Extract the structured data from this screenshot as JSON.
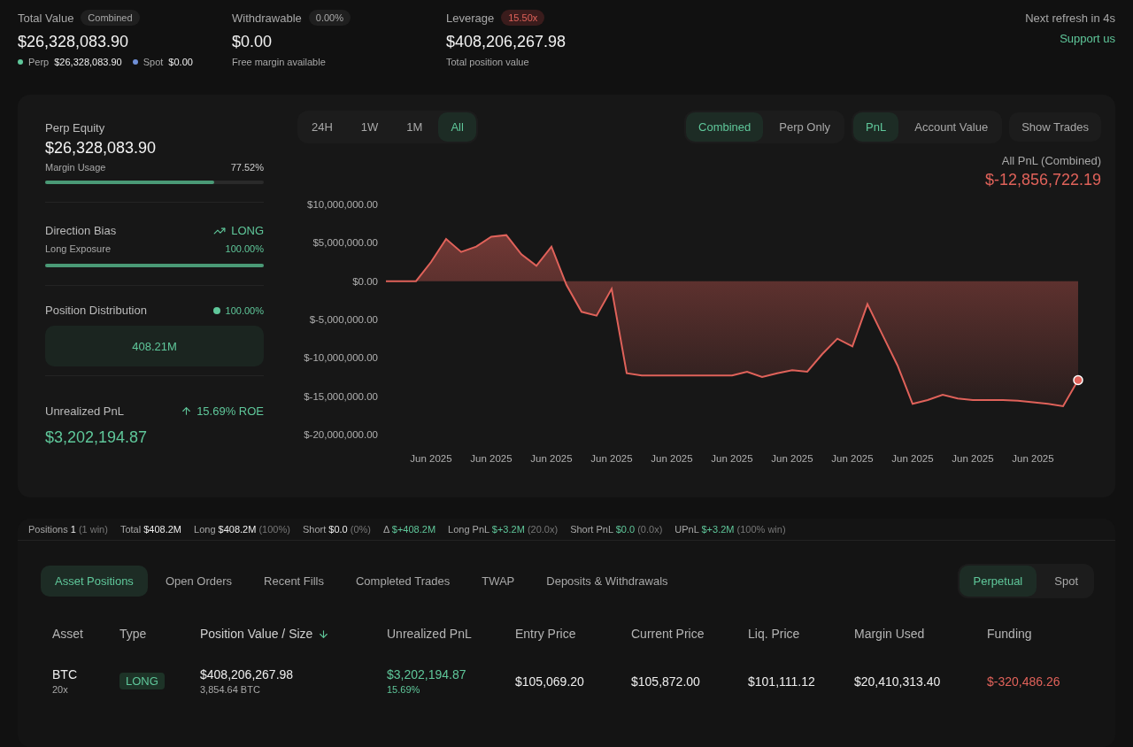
{
  "metrics": [
    {
      "label": "Total Value",
      "badge": "Combined",
      "alert": false,
      "value": "$26,328,083.90",
      "breakdown": [
        {
          "label": "Perp",
          "value": "$26,328,083.90",
          "color": "#5fc79a"
        },
        {
          "label": "Spot",
          "value": "$0.00",
          "color": "#6f8fd6"
        }
      ]
    },
    {
      "label": "Withdrawable",
      "badge": "0.00%",
      "alert": false,
      "value": "$0.00",
      "note": "Free margin available"
    },
    {
      "label": "Leverage",
      "badge": "15.50x",
      "alert": true,
      "value": "$408,206,267.98",
      "note": "Total position value"
    }
  ],
  "refresh": "Next refresh in 4s",
  "support_link": "Support us",
  "perp_equity": {
    "label": "Perp Equity",
    "value": "$26,328,083.90",
    "meter": {
      "label": "Margin Usage",
      "reading": "77.52%",
      "level": 0.7752
    }
  },
  "direction_bias": {
    "label": "Direction Bias",
    "direction": "LONG",
    "long": true,
    "meter": {
      "label": "Long Exposure",
      "reading": "100.00%",
      "level": 1
    }
  },
  "position_distribution": {
    "label": "Position Distribution",
    "reading": "100.00%",
    "color": "#5fc79a",
    "bar_label": "408.21M"
  },
  "unrealized_pnl": {
    "label": "Unrealized PnL",
    "roe": "15.69% ROE",
    "value": "$3,202,194.87"
  },
  "range_tabs": [
    {
      "label": "24H",
      "selected": false
    },
    {
      "label": "1W",
      "selected": false
    },
    {
      "label": "1M",
      "selected": false
    },
    {
      "label": "All",
      "selected": true
    }
  ],
  "mode_tabs": [
    {
      "label": "Combined",
      "selected": true
    },
    {
      "label": "Perp Only",
      "selected": false
    }
  ],
  "metric_tabs": [
    {
      "label": "PnL",
      "selected": true
    },
    {
      "label": "Account Value",
      "selected": false
    }
  ],
  "show_trades": "Show Trades",
  "chart": {
    "title": "All PnL (Combined)",
    "total": "$-12,856,722.19",
    "chart_data": {
      "type": "area",
      "categories": [
        null,
        null,
        null,
        "Jun 2025",
        null,
        null,
        null,
        "Jun 2025",
        null,
        null,
        null,
        "Jun 2025",
        null,
        null,
        null,
        "Jun 2025",
        null,
        null,
        null,
        "Jun 2025",
        null,
        null,
        null,
        "Jun 2025",
        null,
        null,
        null,
        "Jun 2025",
        null,
        null,
        null,
        "Jun 2025",
        null,
        null,
        null,
        "Jun 2025",
        null,
        null,
        null,
        "Jun 2025",
        null,
        null,
        null,
        "Jun 2025",
        null,
        null,
        null
      ],
      "values": [
        0,
        0,
        0,
        2500000,
        5500000,
        3800000,
        4500000,
        5800000,
        6000000,
        3500000,
        2000000,
        4500000,
        -500000,
        -4000000,
        -4500000,
        -1000000,
        -12000000,
        -12300000,
        -12300000,
        -12300000,
        -12300000,
        -12300000,
        -12300000,
        -12300000,
        -11800000,
        -12500000,
        -12000000,
        -11600000,
        -11800000,
        -9500000,
        -7500000,
        -8500000,
        -3000000,
        -7000000,
        -11000000,
        -16000000,
        -15500000,
        -14800000,
        -15300000,
        -15500000,
        -15500000,
        -15500000,
        -15600000,
        -15800000,
        -16000000,
        -16300000,
        -12900000
      ],
      "ylim": [
        -20000000,
        10000000
      ],
      "yticks": [
        {
          "value": 10000000,
          "label": "$10,000,000.00"
        },
        {
          "value": 5000000,
          "label": "$5,000,000.00"
        },
        {
          "value": 0,
          "label": "$0.00"
        },
        {
          "value": -5000000,
          "label": "$-5,000,000.00"
        },
        {
          "value": -10000000,
          "label": "$-10,000,000.00"
        },
        {
          "value": -15000000,
          "label": "$-15,000,000.00"
        },
        {
          "value": -20000000,
          "label": "$-20,000,000.00"
        }
      ]
    }
  },
  "stats": [
    {
      "label": "Positions",
      "value": "1",
      "note": "(1 win)",
      "positive": false
    },
    {
      "label": "Total",
      "value": "$408.2M",
      "positive": false
    },
    {
      "label": "Long",
      "value": "$408.2M",
      "note": "(100%)",
      "positive": false
    },
    {
      "label": "Short",
      "value": "$0.0",
      "note": "(0%)",
      "positive": false
    },
    {
      "label": "Δ",
      "value": "$+408.2M",
      "positive": true
    },
    {
      "label": "Long PnL",
      "value": "$+3.2M",
      "note": "(20.0x)",
      "positive": true
    },
    {
      "label": "Short PnL",
      "value": "$0.0",
      "note": "(0.0x)",
      "positive": true
    },
    {
      "label": "UPnL",
      "value": "$+3.2M",
      "note": "(100% win)",
      "positive": true
    }
  ],
  "position_tabs": [
    {
      "label": "Asset Positions",
      "selected": true
    },
    {
      "label": "Open Orders",
      "selected": false
    },
    {
      "label": "Recent Fills",
      "selected": false
    },
    {
      "label": "Completed Trades",
      "selected": false
    },
    {
      "label": "TWAP",
      "selected": false
    },
    {
      "label": "Deposits & Withdrawals",
      "selected": false
    }
  ],
  "market_tabs": [
    {
      "label": "Perpetual",
      "selected": true
    },
    {
      "label": "Spot",
      "selected": false
    }
  ],
  "table": {
    "columns": [
      {
        "label": "Asset",
        "sorted": false
      },
      {
        "label": "Type",
        "sorted": false
      },
      {
        "label": "Position Value / Size",
        "sorted": true
      },
      {
        "label": "Unrealized PnL",
        "sorted": false
      },
      {
        "label": "Entry Price",
        "sorted": false
      },
      {
        "label": "Current Price",
        "sorted": false
      },
      {
        "label": "Liq. Price",
        "sorted": false
      },
      {
        "label": "Margin Used",
        "sorted": false
      },
      {
        "label": "Funding",
        "sorted": false
      }
    ],
    "rows": [
      {
        "asset": "BTC",
        "leverage": "20x",
        "type": "LONG",
        "long": true,
        "position_value": "$408,206,267.98",
        "size": "3,854.64 BTC",
        "upnl": "$3,202,194.87",
        "upnl_pct": "15.69%",
        "upnl_positive": true,
        "entry_price": "$105,069.20",
        "current_price": "$105,872.00",
        "liq_price": "$101,111.12",
        "margin_used": "$20,410,313.40",
        "funding": "$-320,486.26",
        "funding_positive": false
      }
    ]
  }
}
